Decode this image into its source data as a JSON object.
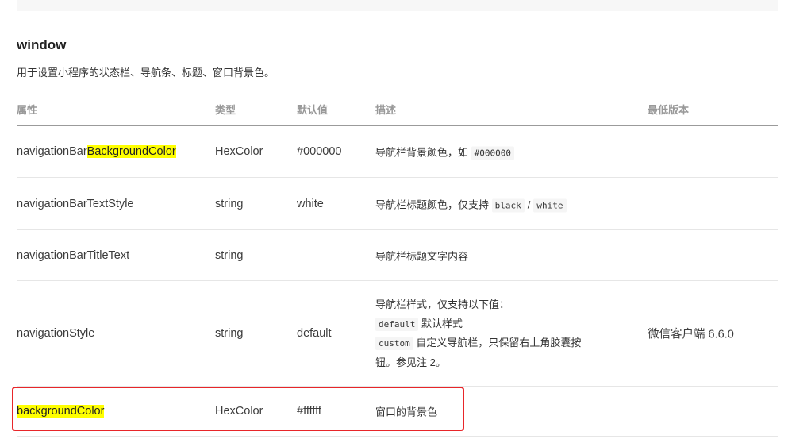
{
  "section": {
    "title": "window",
    "description": "用于设置小程序的状态栏、导航条、标题、窗口背景色。"
  },
  "headers": {
    "property": "属性",
    "type": "类型",
    "default": "默认值",
    "description": "描述",
    "min_version": "最低版本"
  },
  "rows": [
    {
      "prop_prefix": "navigationBar",
      "prop_highlight": "BackgroundColor",
      "type": "HexColor",
      "default": "#000000",
      "desc_text": "导航栏背景颜色，如",
      "desc_code": "#000000"
    },
    {
      "prop": "navigationBarTextStyle",
      "type": "string",
      "default": "white",
      "desc_text": "导航栏标题颜色，仅支持",
      "desc_code1": "black",
      "desc_sep": "/",
      "desc_code2": "white"
    },
    {
      "prop": "navigationBarTitleText",
      "type": "string",
      "desc_text": "导航栏标题文字内容"
    },
    {
      "prop": "navigationStyle",
      "type": "string",
      "default": "default",
      "desc_line1": "导航栏样式，仅支持以下值：",
      "desc_code_default": "default",
      "desc_default_text": "默认样式",
      "desc_code_custom": "custom",
      "desc_custom_text": "自定义导航栏，只保留右上角胶囊按钮。参见注 2。",
      "min_version": "微信客户端 6.6.0"
    },
    {
      "prop_highlight": "backgroundColor",
      "type": "HexColor",
      "default": "#ffffff",
      "desc_text": "窗口的背景色"
    }
  ],
  "colors": {
    "highlight": "#ffff00",
    "annotation_box": "#e8262a"
  }
}
